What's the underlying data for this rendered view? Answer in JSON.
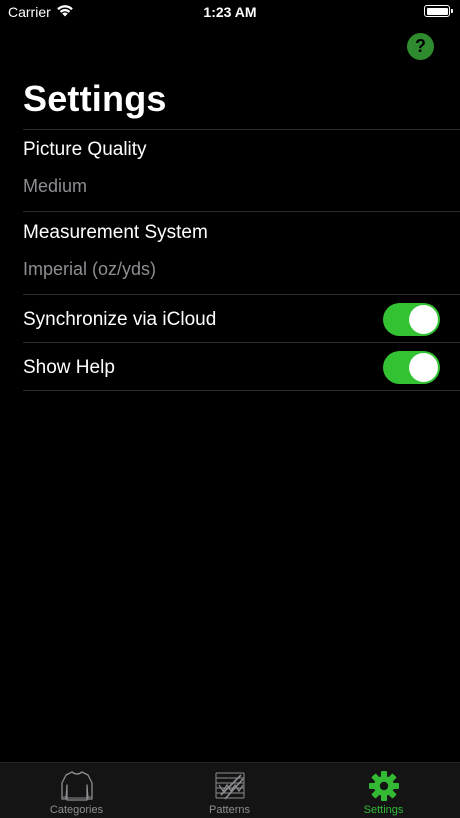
{
  "status_bar": {
    "carrier": "Carrier",
    "time": "1:23 AM"
  },
  "header": {
    "help_label": "?",
    "title": "Settings"
  },
  "settings": {
    "picture_quality": {
      "label": "Picture Quality",
      "value": "Medium"
    },
    "measurement_system": {
      "label": "Measurement System",
      "value": "Imperial (oz/yds)"
    },
    "sync_icloud": {
      "label": "Synchronize via iCloud",
      "enabled": true
    },
    "show_help": {
      "label": "Show Help",
      "enabled": true
    }
  },
  "tab_bar": {
    "tabs": [
      {
        "label": "Categories",
        "icon": "sweater-icon",
        "active": false
      },
      {
        "label": "Patterns",
        "icon": "knitting-chart-icon",
        "active": false
      },
      {
        "label": "Settings",
        "icon": "gear-icon",
        "active": true
      }
    ]
  },
  "colors": {
    "accent": "#34b934",
    "toggle_on": "#32c232",
    "background": "#000000",
    "secondary_text": "#8e8e93"
  }
}
